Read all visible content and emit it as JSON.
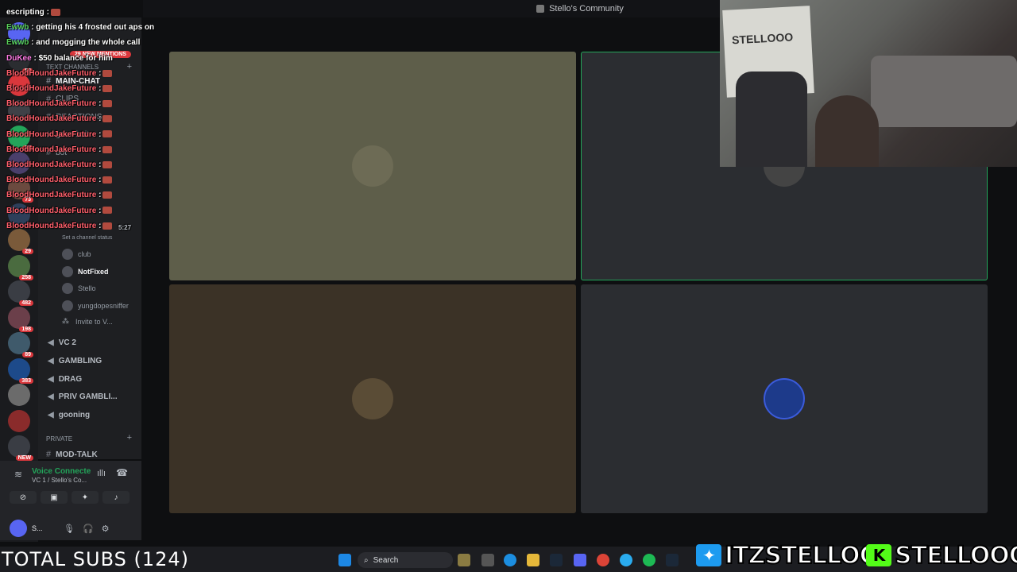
{
  "window": {
    "title": "Stello's Community"
  },
  "servers": [
    {
      "badge": ""
    },
    {
      "badge": "54"
    },
    {
      "badge": ""
    },
    {
      "badge": ""
    },
    {
      "badge": "22"
    },
    {
      "badge": ""
    },
    {
      "badge": "73"
    },
    {
      "badge": ""
    },
    {
      "badge": "29"
    },
    {
      "badge": "258"
    },
    {
      "badge": "482"
    },
    {
      "badge": "198"
    },
    {
      "badge": "89"
    },
    {
      "badge": "383"
    },
    {
      "badge": ""
    },
    {
      "badge": ""
    },
    {
      "badge": "NEW"
    }
  ],
  "channels": {
    "mentions_badge": "29 NEW MENTIONS",
    "text_category": "text channels",
    "text": [
      {
        "name": "MAIN-CHAT",
        "active": true
      },
      {
        "name": "CLIPS",
        "active": false
      },
      {
        "name": "REACTIONS",
        "active": false
      },
      {
        "name": "goon-bait",
        "active": false
      },
      {
        "name": "bot",
        "active": false
      }
    ],
    "status_hint": "Set a channel status",
    "vc1_members": [
      {
        "name": "club",
        "bold": false
      },
      {
        "name": "NotFixed",
        "bold": true
      },
      {
        "name": "Stello",
        "bold": false
      },
      {
        "name": "yungdopesniffer",
        "bold": false
      }
    ],
    "invite_label": "Invite to V...",
    "voice": [
      {
        "name": "VC 2"
      },
      {
        "name": "GAMBLING"
      },
      {
        "name": "DRAG"
      },
      {
        "name": "PRIV GAMBLI..."
      },
      {
        "name": "gooning"
      }
    ],
    "private_category": "PRIVATE",
    "private": [
      {
        "name": "MOD-TALK"
      }
    ]
  },
  "voice_panel": {
    "status": "Voice Connecte",
    "location": "VC 1 / Stello's Co...",
    "user_short": "S..."
  },
  "chat_overlay": [
    {
      "user": "",
      "text": "escripting :",
      "color": "u"
    },
    {
      "user": "Ewwb",
      "text": ": getting his 4 frosted out aps on",
      "color": "u2"
    },
    {
      "user": "Ewwb",
      "text": ": and mogging the whole call",
      "color": "u2"
    },
    {
      "user": "DuKee",
      "text": ": $50 balance for him",
      "color": "u3"
    },
    {
      "user": "BloodHoundJakeFuture",
      "text": ":",
      "color": "u"
    },
    {
      "user": "BloodHoundJakeFuture",
      "text": ":",
      "color": "u"
    },
    {
      "user": "BloodHoundJakeFuture",
      "text": ":",
      "color": "u"
    },
    {
      "user": "BloodHoundJakeFuture",
      "text": ":",
      "color": "u"
    },
    {
      "user": "BloodHoundJakeFuture",
      "text": ":",
      "color": "u"
    },
    {
      "user": "BloodHoundJakeFuture",
      "text": ":",
      "color": "u"
    },
    {
      "user": "BloodHoundJakeFuture",
      "text": ":",
      "color": "u"
    },
    {
      "user": "BloodHoundJakeFuture",
      "text": ":",
      "color": "u"
    },
    {
      "user": "BloodHoundJakeFuture",
      "text": ":",
      "color": "u"
    },
    {
      "user": "BloodHoundJakeFuture",
      "text": ":",
      "color": "u"
    },
    {
      "user": "BloodHoundJakeFuture",
      "text": ":",
      "color": "u"
    }
  ],
  "overlay_timer": "5:27",
  "tiles": [
    {
      "bg": "#5e5e4a",
      "avatar": "#6d6b55"
    },
    {
      "bg": "#2b2d31",
      "avatar": "#444"
    },
    {
      "bg": "#3b3226",
      "avatar": "#5a4c36"
    },
    {
      "bg": "#2b2d31",
      "avatar": "#1d3a8a"
    }
  ],
  "webcam": {
    "sign_text": "STELLOOO"
  },
  "taskbar": {
    "search_label": "Search"
  },
  "stream_overlay": {
    "subs": "TOTAL SUBS (124)",
    "twitter": "ITZSTELLOO",
    "kick": "STELLOOO"
  },
  "colors": {
    "accent_green": "#23a55a",
    "kick_green": "#53fc18",
    "twitter_blue": "#1d9bf0",
    "alert_red": "#da373c"
  }
}
